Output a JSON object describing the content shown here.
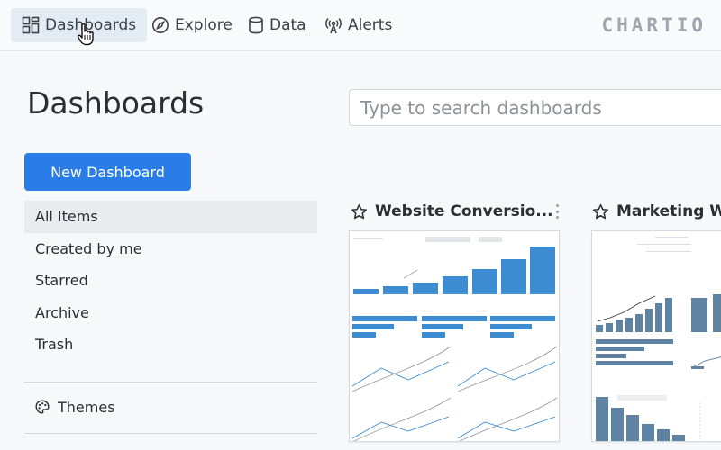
{
  "nav": {
    "items": [
      {
        "label": "Dashboards",
        "icon": "dashboards-grid-icon",
        "active": true
      },
      {
        "label": "Explore",
        "icon": "compass-icon"
      },
      {
        "label": "Data",
        "icon": "database-icon"
      },
      {
        "label": "Alerts",
        "icon": "antenna-icon"
      }
    ],
    "brand": "CHARTIO"
  },
  "page": {
    "title": "Dashboards",
    "search_placeholder": "Type to search dashboards"
  },
  "sidebar": {
    "new_button": "New Dashboard",
    "items": [
      {
        "label": "All Items",
        "active": true
      },
      {
        "label": "Created by me"
      },
      {
        "label": "Starred"
      },
      {
        "label": "Archive"
      },
      {
        "label": "Trash"
      }
    ],
    "themes_label": "Themes",
    "themes_icon": "palette-icon"
  },
  "cards": [
    {
      "title": "Website Conversio...",
      "icon": "star-outline-icon",
      "menu_icon": "kebab-menu-icon"
    },
    {
      "title": "Marketing We",
      "icon": "star-outline-icon"
    }
  ],
  "colors": {
    "accent": "#2a7de8",
    "chart_blue": "#3d8bd1",
    "chart_slate": "#5f84a3"
  }
}
